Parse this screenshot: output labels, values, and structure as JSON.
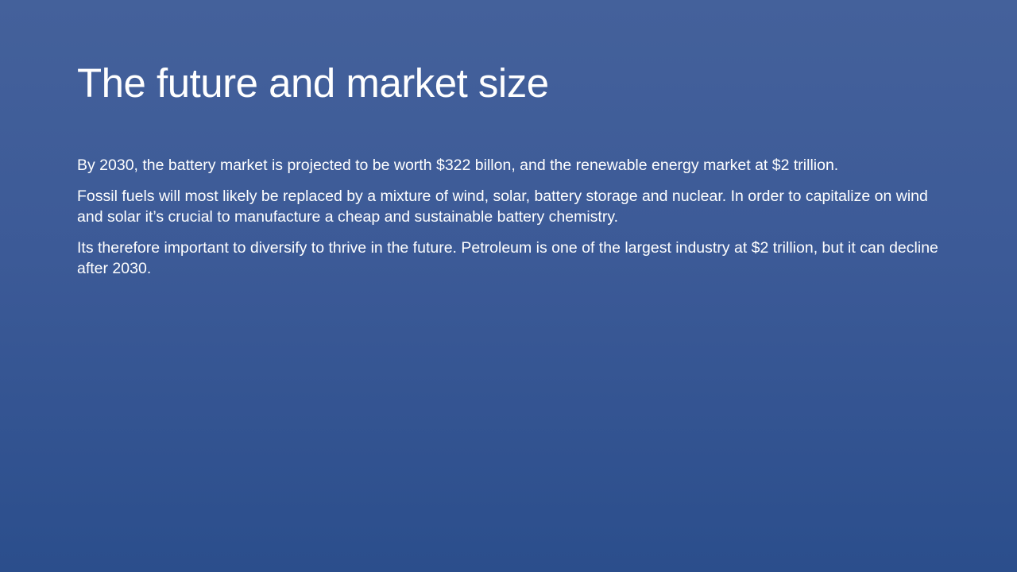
{
  "slide": {
    "title": "The future and market size",
    "paragraphs": [
      "By 2030, the battery market is projected to be worth $322 billon, and the renewable energy market at $2 trillion.",
      "Fossil fuels will most likely be replaced by a mixture of wind, solar, battery storage and nuclear. In order to capitalize on wind and solar it’s crucial to manufacture a cheap and sustainable battery chemistry.",
      "Its therefore important to diversify to thrive in the future. Petroleum is one of the largest industry at $2 trillion, but it can decline after 2030."
    ]
  },
  "colors": {
    "background_top": "#44619b",
    "background_bottom": "#2b4e8c",
    "text": "#ffffff"
  }
}
